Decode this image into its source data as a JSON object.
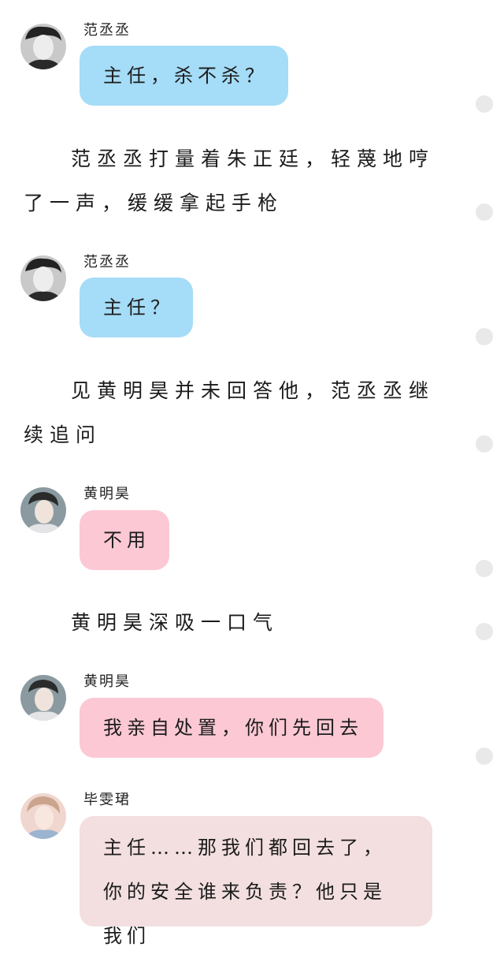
{
  "messages": [
    {
      "speaker": "范丞丞",
      "text": "主任，杀不杀？"
    },
    {
      "speaker": "范丞丞",
      "text": "主任？"
    },
    {
      "speaker": "黄明昊",
      "text": "不用"
    },
    {
      "speaker": "黄明昊",
      "text": "我亲自处置，你们先回去"
    },
    {
      "speaker": "毕雯珺",
      "text": "主任……那我们都回去了，你的安全谁来负责？他只是我们"
    }
  ],
  "narrations": [
    "范丞丞打量着朱正廷，轻蔑地哼了一声，缓缓拿起手枪",
    "见黄明昊并未回答他，范丞丞继续追问",
    "黄明昊深吸一口气"
  ],
  "colors": {
    "bubble_blue": "#a5dcf7",
    "bubble_pink": "#fbc8d4",
    "bubble_pale": "#f3dfe0",
    "side_dot": "#e9e9ea"
  }
}
